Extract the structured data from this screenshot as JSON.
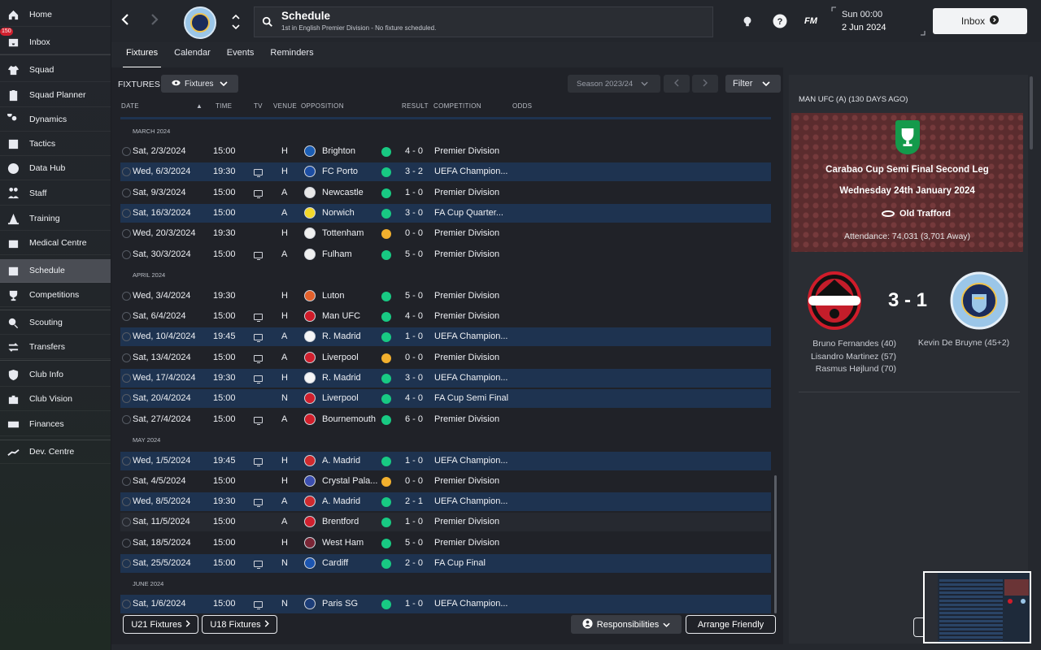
{
  "sidebar": {
    "items": [
      {
        "label": "Home",
        "icon": "home-icon"
      },
      {
        "label": "Inbox",
        "icon": "inbox-icon",
        "badge": "150"
      },
      {
        "label": "Squad",
        "icon": "shirt-icon"
      },
      {
        "label": "Squad Planner",
        "icon": "clipboard-icon"
      },
      {
        "label": "Dynamics",
        "icon": "dynamics-icon"
      },
      {
        "label": "Tactics",
        "icon": "tactics-icon"
      },
      {
        "label": "Data Hub",
        "icon": "data-hub-icon"
      },
      {
        "label": "Staff",
        "icon": "staff-icon"
      },
      {
        "label": "Training",
        "icon": "training-cone-icon"
      },
      {
        "label": "Medical Centre",
        "icon": "medical-icon"
      },
      {
        "label": "Schedule",
        "icon": "calendar-icon"
      },
      {
        "label": "Competitions",
        "icon": "trophy-icon"
      },
      {
        "label": "Scouting",
        "icon": "magnifier-icon"
      },
      {
        "label": "Transfers",
        "icon": "transfer-icon"
      },
      {
        "label": "Club Info",
        "icon": "shield-icon"
      },
      {
        "label": "Club Vision",
        "icon": "briefcase-icon"
      },
      {
        "label": "Finances",
        "icon": "money-icon"
      },
      {
        "label": "Dev. Centre",
        "icon": "dev-centre-icon"
      }
    ]
  },
  "header": {
    "title": "Schedule",
    "subtitle": "1st in English Premier Division - No fixture scheduled.",
    "fm_logo": "FM",
    "time": "Sun 00:00",
    "date": "2 Jun 2024",
    "inbox_label": "Inbox"
  },
  "tabs": [
    "Fixtures",
    "Calendar",
    "Events",
    "Reminders"
  ],
  "toolbar": {
    "fixtures_title": "FIXTURES",
    "fixtures_dropdown": "Fixtures",
    "season": "Season 2023/24",
    "filter": "Filter"
  },
  "columns": [
    "DATE",
    "TIME",
    "TV",
    "VENUE",
    "OPPOSITION",
    "RESULT",
    "COMPETITION",
    "ODDS"
  ],
  "sections": [
    {
      "label": "MARCH 2024"
    },
    {
      "label": "APRIL 2024"
    },
    {
      "label": "MAY 2024"
    },
    {
      "label": "JUNE 2024"
    }
  ],
  "fixtures": [
    {
      "date": "Sat, 2/3/2024",
      "time": "15:00",
      "tv": false,
      "venue": "H",
      "opp": "Brighton",
      "res_type": "win",
      "result": "4 - 0",
      "comp": "Premier Division",
      "logo_color": "#1b5eb5"
    },
    {
      "date": "Wed, 6/3/2024",
      "time": "19:30",
      "tv": true,
      "venue": "H",
      "opp": "FC Porto",
      "res_type": "win",
      "result": "3 - 2",
      "comp": "UEFA Champion...",
      "logo_color": "#1d4ea3"
    },
    {
      "date": "Sat, 9/3/2024",
      "time": "15:00",
      "tv": true,
      "venue": "A",
      "opp": "Newcastle",
      "res_type": "win",
      "result": "1 - 0",
      "comp": "Premier Division",
      "logo_color": "#e8e8e8"
    },
    {
      "date": "Sat, 16/3/2024",
      "time": "15:00",
      "tv": false,
      "venue": "A",
      "opp": "Norwich",
      "res_type": "win",
      "result": "3 - 0",
      "comp": "FA Cup Quarter...",
      "logo_color": "#f4d92a"
    },
    {
      "date": "Wed, 20/3/2024",
      "time": "19:30",
      "tv": false,
      "venue": "H",
      "opp": "Tottenham",
      "res_type": "draw",
      "result": "0 - 0",
      "comp": "Premier Division",
      "logo_color": "#f0f0f0"
    },
    {
      "date": "Sat, 30/3/2024",
      "time": "15:00",
      "tv": true,
      "venue": "A",
      "opp": "Fulham",
      "res_type": "win",
      "result": "5 - 0",
      "comp": "Premier Division",
      "logo_color": "#f0f0f0"
    },
    {
      "date": "Wed, 3/4/2024",
      "time": "19:30",
      "tv": false,
      "venue": "H",
      "opp": "Luton",
      "res_type": "win",
      "result": "5 - 0",
      "comp": "Premier Division",
      "logo_color": "#e3612c"
    },
    {
      "date": "Sat, 6/4/2024",
      "time": "15:00",
      "tv": true,
      "venue": "H",
      "opp": "Man UFC",
      "res_type": "win",
      "result": "4 - 0",
      "comp": "Premier Division",
      "logo_color": "#d01c2a"
    },
    {
      "date": "Wed, 10/4/2024",
      "time": "19:45",
      "tv": true,
      "venue": "A",
      "opp": "R. Madrid",
      "res_type": "win",
      "result": "1 - 0",
      "comp": "UEFA Champion...",
      "logo_color": "#f5f5f5"
    },
    {
      "date": "Sat, 13/4/2024",
      "time": "15:00",
      "tv": true,
      "venue": "A",
      "opp": "Liverpool",
      "res_type": "draw",
      "result": "0 - 0",
      "comp": "Premier Division",
      "logo_color": "#d0202e"
    },
    {
      "date": "Wed, 17/4/2024",
      "time": "19:30",
      "tv": true,
      "venue": "H",
      "opp": "R. Madrid",
      "res_type": "win",
      "result": "3 - 0",
      "comp": "UEFA Champion...",
      "logo_color": "#f5f5f5"
    },
    {
      "date": "Sat, 20/4/2024",
      "time": "15:00",
      "tv": false,
      "venue": "N",
      "opp": "Liverpool",
      "res_type": "win",
      "result": "4 - 0",
      "comp": "FA Cup Semi Final",
      "logo_color": "#d0202e"
    },
    {
      "date": "Sat, 27/4/2024",
      "time": "15:00",
      "tv": true,
      "venue": "A",
      "opp": "Bournemouth",
      "res_type": "win",
      "result": "6 - 0",
      "comp": "Premier Division",
      "logo_color": "#d21f2b"
    },
    {
      "date": "Wed, 1/5/2024",
      "time": "19:45",
      "tv": true,
      "venue": "H",
      "opp": "A. Madrid",
      "res_type": "win",
      "result": "1 - 0",
      "comp": "UEFA Champion...",
      "logo_color": "#cf2a2e"
    },
    {
      "date": "Sat, 4/5/2024",
      "time": "15:00",
      "tv": false,
      "venue": "H",
      "opp": "Crystal Pala...",
      "res_type": "draw",
      "result": "0 - 0",
      "comp": "Premier Division",
      "logo_color": "#3c4fb0"
    },
    {
      "date": "Wed, 8/5/2024",
      "time": "19:30",
      "tv": true,
      "venue": "A",
      "opp": "A. Madrid",
      "res_type": "win",
      "result": "2 - 1",
      "comp": "UEFA Champion...",
      "logo_color": "#cf2a2e"
    },
    {
      "date": "Sat, 11/5/2024",
      "time": "15:00",
      "tv": false,
      "venue": "A",
      "opp": "Brentford",
      "res_type": "win",
      "result": "1 - 0",
      "comp": "Premier Division",
      "logo_color": "#d0202e"
    },
    {
      "date": "Sat, 18/5/2024",
      "time": "15:00",
      "tv": false,
      "venue": "H",
      "opp": "West Ham",
      "res_type": "win",
      "result": "5 - 0",
      "comp": "Premier Division",
      "logo_color": "#7a2636"
    },
    {
      "date": "Sat, 25/5/2024",
      "time": "15:00",
      "tv": true,
      "venue": "N",
      "opp": "Cardiff",
      "res_type": "win",
      "result": "2 - 0",
      "comp": "FA Cup Final",
      "logo_color": "#1c55b0"
    },
    {
      "date": "Sat, 1/6/2024",
      "time": "15:00",
      "tv": true,
      "venue": "N",
      "opp": "Paris SG",
      "res_type": "win",
      "result": "1 - 0",
      "comp": "UEFA Champion...",
      "logo_color": "#1c3d78"
    }
  ],
  "buttons": {
    "u21": "U21 Fixtures",
    "u18": "U18 Fixtures",
    "responsibilities": "Responsibilities",
    "arrange_friendly": "Arrange Friendly"
  },
  "last_match": {
    "title": "MAN UFC (A) (130 DAYS AGO)",
    "competition": "Carabao Cup Semi Final Second Leg",
    "date": "Wednesday 24th January 2024",
    "stadium": "Old Trafford",
    "attendance": "Attendance: 74,031 (3,701 Away)",
    "score": "3 - 1",
    "home_scorers": [
      "Bruno Fernandes (40)",
      "Lisandro Martinez (57)",
      "Rasmus Højlund (70)"
    ],
    "away_scorers": [
      "Kevin De Bruyne (45+2)"
    ],
    "cup_logo_text": "Carabao Cup"
  },
  "crest_text": "MANCHESTER CITY",
  "colors": {
    "win": "#18c983",
    "draw": "#f2b02e",
    "highlight_row": "#1e3350",
    "inbox_badge": "#d0202e"
  }
}
